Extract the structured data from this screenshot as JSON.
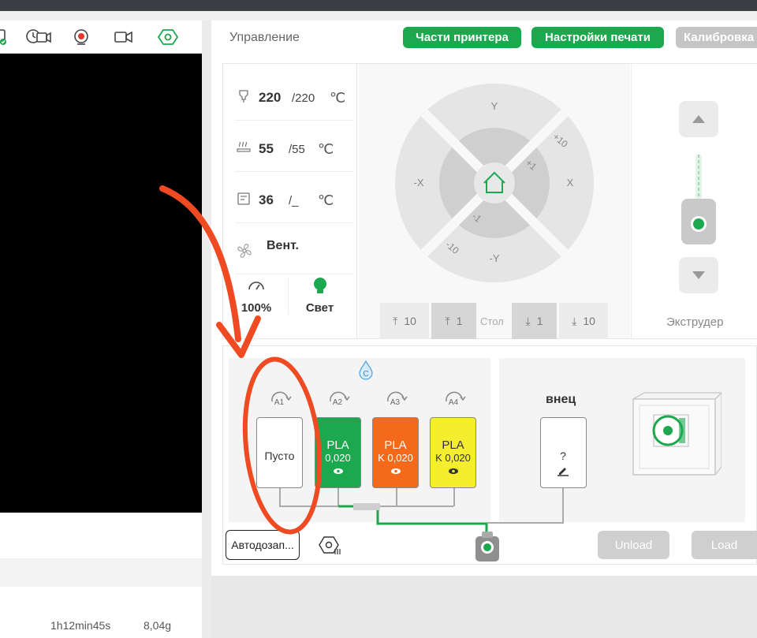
{
  "header": {
    "title": "Управление",
    "tabs": [
      {
        "label": "Части принтера"
      },
      {
        "label": "Настройки печати"
      },
      {
        "label": "Калибровка"
      }
    ]
  },
  "left_panel": {
    "print_time": "1h12min45s",
    "print_weight": "8,04g"
  },
  "temps": {
    "nozzle": {
      "current": "220",
      "target": "/220",
      "unit": "℃"
    },
    "bed": {
      "current": "55",
      "target": "/55",
      "unit": "℃"
    },
    "chamber": {
      "current": "36",
      "target": "/_",
      "unit": "℃"
    }
  },
  "fan_label": "Вент.",
  "speed": {
    "value": "100%"
  },
  "light": {
    "label": "Свет"
  },
  "jog": {
    "y_pos": "Y",
    "y_neg": "-Y",
    "x_neg": "-X",
    "x_pos": "X",
    "step_10": "+10",
    "step_1": "+1",
    "step_neg1": "-1",
    "step_neg10": "-10"
  },
  "bed_move": {
    "label": "Стол",
    "up10": "10",
    "up1": "1",
    "down1": "1",
    "down10": "10"
  },
  "extruder_label": "Экструдер",
  "ams": {
    "slots": [
      {
        "badge": "A1",
        "line1": "Пусто",
        "line2": "",
        "color": "#ffffff"
      },
      {
        "badge": "A2",
        "line1": "PLA",
        "line2": "0,020",
        "color": "#1ca84e"
      },
      {
        "badge": "A3",
        "line1": "PLA",
        "line2": "K 0,020",
        "color": "#f46a1a"
      },
      {
        "badge": "A4",
        "line1": "PLA",
        "line2": "K 0,020",
        "color": "#f5ee2e"
      }
    ],
    "nozzle_label": "внец",
    "nozzle_card": "?"
  },
  "buttons": {
    "autofill": "Автодозап...",
    "unload": "Unload",
    "load": "Load"
  },
  "colors": {
    "accent": "#1ca84e",
    "annotation": "#f04a23"
  }
}
